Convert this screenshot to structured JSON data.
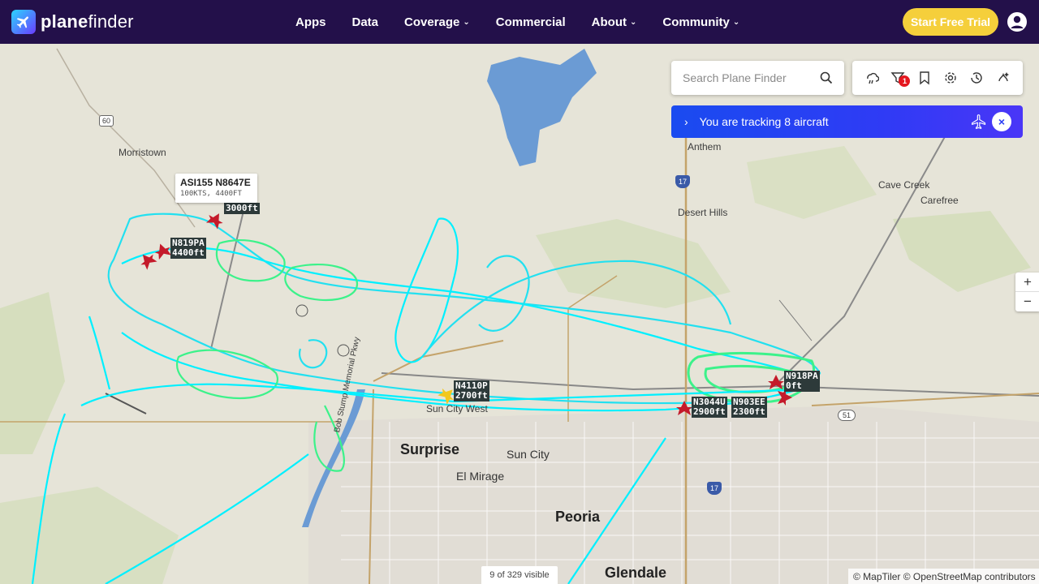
{
  "header": {
    "logo_text_bold": "plane",
    "logo_text_rest": "finder",
    "nav": [
      {
        "label": "Apps",
        "dropdown": false
      },
      {
        "label": "Data",
        "dropdown": false
      },
      {
        "label": "Coverage",
        "dropdown": true
      },
      {
        "label": "Commercial",
        "dropdown": false
      },
      {
        "label": "About",
        "dropdown": true
      },
      {
        "label": "Community",
        "dropdown": true
      }
    ],
    "cta_label": "Start Free Trial",
    "colors": {
      "bar": "#23104a",
      "cta": "#f5cf3b"
    }
  },
  "search": {
    "placeholder": "Search Plane Finder"
  },
  "toolbar": {
    "icons": [
      "weather-icon",
      "filter-icon",
      "bookmark-icon",
      "settings-icon",
      "history-icon",
      "ai-icon"
    ],
    "filter_badge": "1"
  },
  "tracking": {
    "text": "You are tracking 8 aircraft",
    "close": "×"
  },
  "zoom": {
    "in": "+",
    "out": "−"
  },
  "tooltip": {
    "title": "ASI155 N8647E",
    "detail": "100KTS, 4400FT"
  },
  "aircraft": [
    {
      "callsign": "N819PA",
      "altitude": "4400ft"
    },
    {
      "callsign": "",
      "altitude": "3000ft"
    },
    {
      "callsign": "N4110P",
      "altitude": "2700ft"
    },
    {
      "callsign": "N918PA",
      "altitude": "0ft"
    },
    {
      "callsign": "N3044U",
      "altitude": "2900ft"
    },
    {
      "callsign": "N903EE",
      "altitude": "2300ft"
    }
  ],
  "places": {
    "morristown": "Morristown",
    "anthem": "Anthem",
    "cave_creek": "Cave Creek",
    "carefree": "Carefree",
    "desert_hills": "Desert Hills",
    "surprise": "Surprise",
    "sun_city": "Sun City",
    "sun_city_west": "Sun City West",
    "el_mirage": "El Mirage",
    "peoria": "Peoria",
    "glendale": "Glendale",
    "bob_stump": "Bob Stump Memorial Pkwy"
  },
  "shields": {
    "us60": "60",
    "i17a": "17",
    "i17b": "17",
    "sr51": "51"
  },
  "footer": {
    "visible": "9 of 329 visible",
    "attribution": "© MapTiler © OpenStreetMap contributors"
  }
}
